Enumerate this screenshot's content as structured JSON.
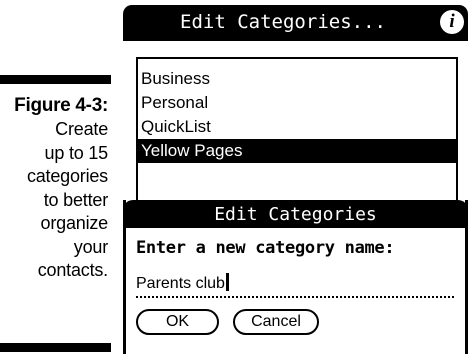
{
  "caption": {
    "figure": "Figure 4-3:",
    "lines": [
      "Create",
      "up to 15",
      "categories",
      "to better",
      "organize",
      "your",
      "contacts."
    ]
  },
  "screen": {
    "title": "Edit Categories...",
    "info_icon": "info-icon",
    "categories": [
      "Business",
      "Personal",
      "QuickList",
      "Yellow Pages"
    ],
    "selected_index": 3
  },
  "dialog": {
    "title": "Edit Categories",
    "prompt": "Enter a new category name:",
    "input_value": "Parents club",
    "ok_label": "OK",
    "cancel_label": "Cancel"
  }
}
